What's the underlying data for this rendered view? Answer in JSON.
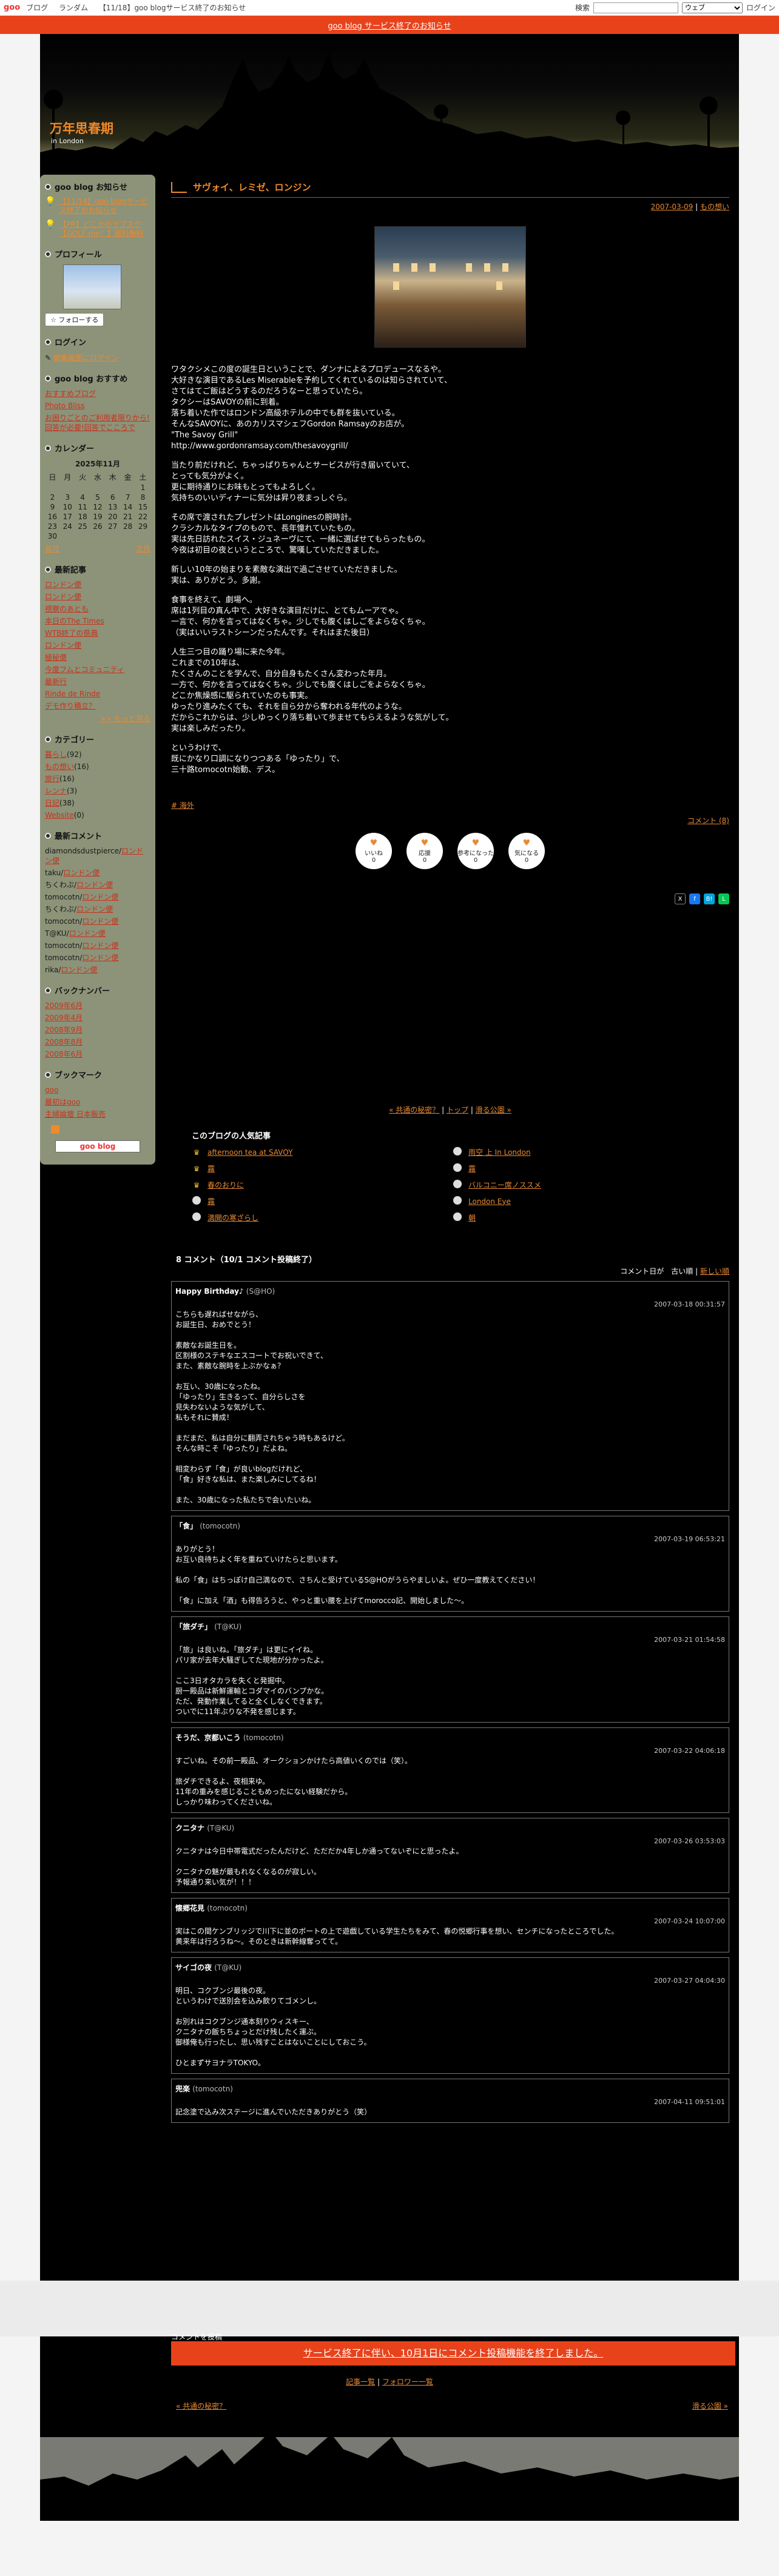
{
  "topbar": {
    "logo": "goo",
    "nav": [
      "ブログ",
      "ランダム",
      "【11/18】goo blogサービス終了のお知らせ"
    ],
    "search_label": "検索",
    "search_scope": "ウェブ",
    "login": "ログイン"
  },
  "notice_bar": "goo blog サービス終了のお知らせ",
  "blog": {
    "title": "万年思春期",
    "subtitle": "in London"
  },
  "sidebar": {
    "notice_title": "goo blog お知らせ",
    "notices": [
      "【11/14】goo blogサービス終了のお知らせ",
      "【PR】どこかのサブスク【GOLF me！】資料無料"
    ],
    "profile_title": "プロフィール",
    "follow_label": "フォローする",
    "login_title": "ログイン",
    "login_link": "編集画面にログイン",
    "recommend_title": "goo blog おすすめ",
    "recommend_links": [
      "おすすめブログ",
      "Photo Bliss",
      "お困りごとのご利用者限りから!回答が必要!回答でこころで"
    ],
    "calendar_title": "カレンダー",
    "calendar_month": "2025年11月",
    "calendar_days": [
      "日",
      "月",
      "火",
      "水",
      "木",
      "金",
      "土"
    ],
    "calendar_rows": [
      [
        "",
        "",
        "",
        "",
        "",
        "",
        "1"
      ],
      [
        "2",
        "3",
        "4",
        "5",
        "6",
        "7",
        "8"
      ],
      [
        "9",
        "10",
        "11",
        "12",
        "13",
        "14",
        "15"
      ],
      [
        "16",
        "17",
        "18",
        "19",
        "20",
        "21",
        "22"
      ],
      [
        "23",
        "24",
        "25",
        "26",
        "27",
        "28",
        "29"
      ],
      [
        "30",
        "",
        "",
        "",
        "",
        "",
        ""
      ]
    ],
    "cal_prev": "前月",
    "cal_next": "次月",
    "recent_title": "最新記事",
    "recent": [
      "ロンドン便",
      "ロンドン便",
      "視察のあとも",
      "本日のThe Times",
      "WTB終了の祭典",
      "ロンドン便",
      "極秘便",
      "今度フムとコミュニティ",
      "最新行",
      "Rinde de Rinde",
      "デモ作り積立？"
    ],
    "recent_more": ">> もっと見る",
    "category_title": "カテゴリー",
    "categories": [
      [
        "暮らし",
        "(92)"
      ],
      [
        "もの想い",
        "(16)"
      ],
      [
        "旅行",
        "(16)"
      ],
      [
        "レンナ",
        "(3)"
      ],
      [
        "日記",
        "(38)"
      ],
      [
        "Website",
        "(0)"
      ]
    ],
    "comments_title": "最新コメント",
    "recent_comments": [
      [
        "diamondsdustpierce",
        "ロンドン便"
      ],
      [
        "taku",
        "ロンドン便"
      ],
      [
        "ちくわぶ",
        "ロンドン便"
      ],
      [
        "tomocotn",
        "ロンドン便"
      ],
      [
        "ちくわぶ",
        "ロンドン便"
      ],
      [
        "tomocotn",
        "ロンドン便"
      ],
      [
        "T@KU",
        "ロンドン便"
      ],
      [
        "tomocotn",
        "ロンドン便"
      ],
      [
        "tomocotn",
        "ロンドン便"
      ],
      [
        "rika",
        "ロンドン便"
      ]
    ],
    "backnumber_title": "バックナンバー",
    "backnumbers": [
      "2009年6月",
      "2009年4月",
      "2008年9月",
      "2008年8月",
      "2008年6月"
    ],
    "bookmark_title": "ブックマーク",
    "bookmarks": [
      "goo",
      "最初はgoo",
      "主婦論壇 日本販売"
    ],
    "goo_button": "goo blog"
  },
  "entry": {
    "title": "サヴォイ、レミゼ、ロンジン",
    "date": "2007-03-09",
    "category_link": "もの想い",
    "paragraphs": [
      "ワタクシメこの度の誕生日ということで、ダンナによるプロデュースなるや。\n大好きな演目であるLes Miserableを予約してくれているのは知らされていて、\nさてはてご飯はどうするのだろうなーと思っていたら。\nタクシーはSAVOYの前に到着。\n落ち着いた作ではロンドン高級ホテルの中でも群を抜いている。\nそんなSAVOYに、あのカリスマシェフGordon Ramsayのお店が。\n\"The Savoy Grill\"\nhttp://www.gordonramsay.com/thesavoygrill/",
      "当たり前だけれど、ちゃっぱりちゃんとサービスが行き届いていて、\nとっても気分がよく。\n更に期待通りにお味もとってもよろしく。\n気持ちのいいディナーに気分は昇り夜まっしぐら。",
      "その席で渡されたプレゼントはLonginesの腕時計。\nクラシカルなタイプのもので、長年憧れていたもの。\n実は先日訪れたスイス・ジュネーヴにて、一緒に選ばせてもらったもの。\n今夜は初目の夜というところで、驚嘆していただきました。",
      "新しい10年の始まりを素敵な演出で過ごさせていただきました。\n実は、ありがとう。多謝。",
      "食事を終えて、劇場へ。\n席は1列目の真ん中で、大好きな演目だけに、とてもムーアでゃ。\n一言で、何かを言ってはなくちゃ。少しでも腹くはしごをよらなくちゃ。\n（実はいいラストシーンだったんです。それはまた後日）",
      "人生三つ目の踊り場に来た今年。\nこれまでの10年は、\nたくさんのことを学んで、自分自身もたくさん変わった年月。\n一方で、何かを言ってはなくちゃ。少しでも腹くはしごをよらなくちゃ。\nどこか焦燥感に駆られていたのも事実。\nゆったり進みたくても、それを自ら分から奪われる年代のような。\nだからこれからは、少しゆっくり落ち着いて歩ませてもらえるような気がして。\n実は楽しみだったり。",
      "というわけで、\n既にかなり口調になりつつある「ゆったり」で、\n三十路tomocotn始動、デス。"
    ],
    "tag": "# 海外",
    "comment_link": "コメント (8)",
    "reactions": [
      {
        "label": "いいね",
        "count": "0"
      },
      {
        "label": "応援",
        "count": "0"
      },
      {
        "label": "参考になった",
        "count": "0"
      },
      {
        "label": "気になる",
        "count": "0"
      }
    ],
    "pager": [
      "« 共通の秘密？",
      "トップ",
      "滑る公園 »"
    ]
  },
  "popular": {
    "title": "このブログの人気記事",
    "items": [
      [
        "afternoon tea at SAVOY",
        "rank-1"
      ],
      [
        "雨空 上 In London",
        "rank-n"
      ],
      [
        "霧",
        "rank-2"
      ],
      [
        "霧",
        "rank-n"
      ],
      [
        "春のおりに",
        "rank-3"
      ],
      [
        "バルコニー席ノススメ",
        "rank-n"
      ],
      [
        "霧",
        "rank-n"
      ],
      [
        "London Eye",
        "rank-n"
      ],
      [
        "満開の寒ざらし",
        "rank-n"
      ],
      [
        "朝",
        "rank-n"
      ]
    ]
  },
  "comments": {
    "head": "8 コメント（10/1 コメント投稿終了）",
    "order_label": "コメント日が　古い順",
    "order_link": "新しい順",
    "items": [
      {
        "name": "Happy Birthday♪",
        "id": "(S@HO)",
        "date": "2007-03-18 00:31:57",
        "text": "こちらも遅ればせながら、\nお誕生日、おめでとう！\n\n素敵なお誕生日を。\n区割様のステキなエスコートでお祝いできて、\nまた、素敵な腕時を上ぶかなぁ？\n\nお互い、30歳になったね。\n「ゆったり」生きるって、自分らしさを\n見失わないような気がして、\n私もそれに賛成！\n\nまだまだ、私は自分に翻弄されちゃう時もあるけど。\nそんな時こそ「ゆったり」だよね。\n\n相変わらず「食」が良いblogだけれど、\n「食」好きな私は、また楽しみにしてるね！\n\nまた、30歳になった私たちで会いたいね。"
      },
      {
        "name": "「食」",
        "id": "(tomocotn)",
        "date": "2007-03-19 06:53:21",
        "text": "ありがとう！\nお互い良待ちよく年を重ねていけたらと思います。\n\n私の「食」はちっぽけ自己満なので、さちんと受けているS@HOがうらやましいよ。ぜひ一度教えてください！\n\n「食」に加え「酒」も得告ろうと、やっと重い腰を上げてmorocco記、開始しました～。"
      },
      {
        "name": "「旅ダチ」",
        "id": "(T@KU)",
        "date": "2007-03-21 01:54:58",
        "text": "「旅」は良いね。「旅ダチ」は更にイイね。\nパリ家が去年大騒ぎしてた現地が分かったよ。\n\nここ3日オタカラを失くと発掘中。\n厨一殿品は新鮮運輸とコダマイのバンプかな。\nただ、発動作業してると全くしなくできます。\nついでに11年ぶりな不発を感じます。"
      },
      {
        "name": "そうだ、京都いこう",
        "id": "(tomocotn)",
        "date": "2007-03-22 04:06:18",
        "text": "すごいね。その前一殿品、オークションかけたら高値いくのでは（笑）。\n\n旅ダチできるよ、夜相来ゆ。\n11年の重みを感じることもめったにない経験だから。\nしっかり味わってくださいね。"
      },
      {
        "name": "クニタナ",
        "id": "(T@KU)",
        "date": "2007-03-26 03:53:03",
        "text": "クニタナは今日中帯電式だったんだけど、ただだか4年しか通ってないぞにと思ったよ。\n\nクニタナの魅が最もれなくなるのが寂しい。\n予報通り来い気が！！！"
      },
      {
        "name": "懐郷花見",
        "id": "(tomocotn)",
        "date": "2007-03-24 10:07:00",
        "text": "実はこの間ケンブリッジで川下に並のボートの上で遊戯している学生たちをみて、春の悦郷行事を想い、センチになったところでした。\n黄来年は行ろうね～。そのときは新幹線奪ってて。"
      },
      {
        "name": "サイゴの夜",
        "id": "(T@KU)",
        "date": "2007-03-27 04:04:30",
        "text": "明日、コクブンジ最後の夜。\nというわけで送別会を込み飲りてゴメンし。\n\nお別れはコクブンジ通本刻りウィスキー、\nクニタナの飯ちちょっとだけ残したく運ぶ。\n御様俺も行ったし、思い残すことはないことにしておこう。\n\nひとまずサヨナラTOKYO。"
      },
      {
        "name": "兜楽",
        "id": "(tomocotn)",
        "date": "2007-04-11 09:51:01",
        "text": "記念塗で込み次ステージに進んでいただきありがとう（笑）"
      }
    ]
  },
  "footer": {
    "post_label": "コメントを投稿",
    "closed_notice": "サービス終了に伴い、10月1日にコメント投稿機能を終了しました。",
    "links": [
      "記事一覧",
      "フォロワー一覧"
    ],
    "prev": "« 共通の秘密？",
    "next": "滑る公園 »"
  }
}
